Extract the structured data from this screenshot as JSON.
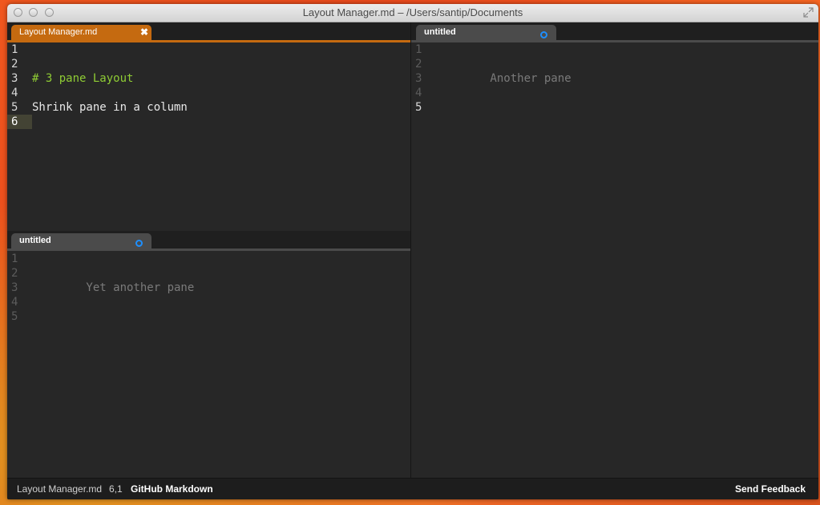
{
  "window": {
    "title": "Layout Manager.md – /Users/santip/Documents"
  },
  "colors": {
    "accent": "#c56a10",
    "heading": "#8fcc34",
    "dirty_indicator": "#1e8fff",
    "active_line": "#434334"
  },
  "panes": {
    "top_left": {
      "tab_label": "Layout Manager.md",
      "close_glyph": "✖",
      "lines": [
        {
          "num": "1",
          "text": ""
        },
        {
          "num": "2",
          "text": ""
        },
        {
          "num": "3",
          "text": "# 3 pane Layout"
        },
        {
          "num": "4",
          "text": ""
        },
        {
          "num": "5",
          "text": "Shrink pane in a column"
        },
        {
          "num": "6",
          "text": ""
        }
      ]
    },
    "right": {
      "tab_label": "untitled",
      "lines": [
        {
          "num": "1",
          "text": ""
        },
        {
          "num": "2",
          "text": ""
        },
        {
          "num": "3",
          "text": "        Another pane"
        },
        {
          "num": "4",
          "text": ""
        },
        {
          "num": "5",
          "text": ""
        }
      ]
    },
    "bottom_left": {
      "tab_label": "untitled",
      "lines": [
        {
          "num": "1",
          "text": ""
        },
        {
          "num": "2",
          "text": ""
        },
        {
          "num": "3",
          "text": "        Yet another pane"
        },
        {
          "num": "4",
          "text": ""
        },
        {
          "num": "5",
          "text": ""
        }
      ]
    }
  },
  "status": {
    "file": "Layout Manager.md",
    "position": "6,1",
    "syntax": "GitHub Markdown",
    "feedback": "Send Feedback"
  }
}
